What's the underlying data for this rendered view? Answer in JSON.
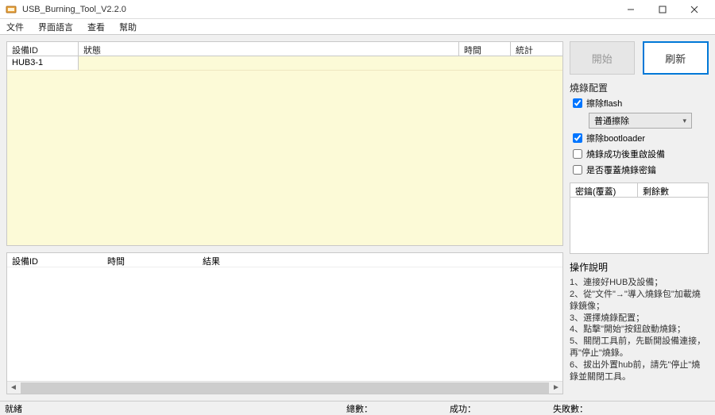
{
  "titlebar": {
    "title": "USB_Burning_Tool_V2.2.0"
  },
  "menubar": {
    "file": "文件",
    "lang": "界面語言",
    "view": "查看",
    "help": "幫助"
  },
  "dev_table": {
    "headers": {
      "id": "設備ID",
      "state": "狀態",
      "time": "時間",
      "stat": "統計"
    },
    "rows": [
      {
        "id": "HUB3-1",
        "state": "",
        "time": "",
        "stat": ""
      }
    ]
  },
  "result_table": {
    "headers": {
      "id": "設備ID",
      "time": "時間",
      "result": "結果"
    }
  },
  "buttons": {
    "start": "開始",
    "refresh": "刷新"
  },
  "cfg": {
    "title": "燒錄配置",
    "erase_flash": "擦除flash",
    "erase_mode": "普通擦除",
    "erase_bootloader": "擦除bootloader",
    "restart": "燒錄成功後重啟設備",
    "overwrite_key": "是否覆蓋燒錄密鑰"
  },
  "key_table": {
    "col1": "密鑰(覆蓋)",
    "col2": "剩餘數"
  },
  "instructions": {
    "title": "操作說明",
    "lines": [
      "1、連接好HUB及設備；",
      "2、從\"文件\"→\"導入燒錄包\"加載燒錄鏡像；",
      "3、選擇燒錄配置；",
      "4、點擊\"開始\"按鈕啟動燒錄；",
      "5、關閉工具前，先斷開設備連接，再\"停止\"燒錄。",
      "6、拔出外置hub前，請先\"停止\"燒錄並關閉工具。"
    ]
  },
  "statusbar": {
    "ready": "就緒",
    "total": "總數：",
    "success": "成功：",
    "fail": "失敗數："
  }
}
